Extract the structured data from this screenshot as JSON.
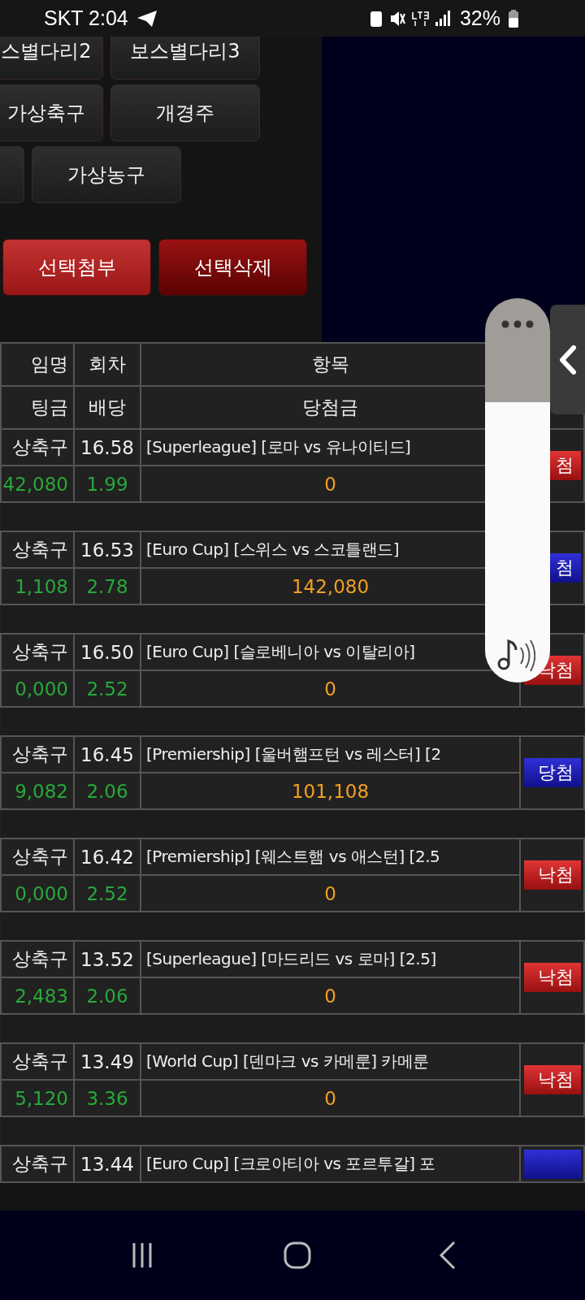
{
  "status_bar": {
    "carrier_time": "SKT 2:04",
    "battery": "32%"
  },
  "menu_rows": [
    {
      "buttons": [
        {
          "label": "스별다리2"
        },
        {
          "label": "보스별다리3"
        }
      ]
    },
    {
      "buttons": [
        {
          "label": "가상축구"
        },
        {
          "label": "개경주"
        }
      ]
    },
    {
      "buttons": [
        {
          "kind": "blank"
        },
        {
          "label": "가상농구"
        }
      ]
    }
  ],
  "actions": [
    {
      "label": "선택첨부",
      "kind": "attach"
    },
    {
      "label": "선택삭제",
      "kind": "delete"
    }
  ],
  "table": {
    "header": [
      [
        "임명",
        "회차",
        "항목"
      ],
      [
        "팅금",
        "배당",
        "당첨금"
      ]
    ],
    "bets": [
      {
        "game": "상축구",
        "round": "16.58",
        "item": "[Superleague] [로마 vs 유나이티드]",
        "stake": "42,080",
        "odds": "1.99",
        "payout": "0",
        "result": {
          "kind": "lose",
          "label": "첨"
        }
      },
      {
        "game": "상축구",
        "round": "16.53",
        "item": "[Euro Cup] [스위스 vs 스코틀랜드]",
        "stake": "1,108",
        "odds": "2.78",
        "payout": "142,080",
        "result": {
          "kind": "win",
          "label": "첨"
        }
      },
      {
        "game": "상축구",
        "round": "16.50",
        "item": "[Euro Cup] [슬로베니아 vs 이탈리아]",
        "stake": "0,000",
        "odds": "2.52",
        "payout": "0",
        "result": {
          "kind": "lose",
          "label": "낙첨"
        }
      },
      {
        "game": "상축구",
        "round": "16.45",
        "item": "[Premiership] [울버햄프턴 vs 레스터] [2",
        "stake": "9,082",
        "odds": "2.06",
        "payout": "101,108",
        "result": {
          "kind": "win",
          "label": "당첨"
        }
      },
      {
        "game": "상축구",
        "round": "16.42",
        "item": "[Premiership] [웨스트햄 vs 애스턴] [2.5",
        "stake": "0,000",
        "odds": "2.52",
        "payout": "0",
        "result": {
          "kind": "lose",
          "label": "낙첨"
        }
      },
      {
        "game": "상축구",
        "round": "13.52",
        "item": "[Superleague] [마드리드 vs 로마] [2.5]",
        "stake": "2,483",
        "odds": "2.06",
        "payout": "0",
        "result": {
          "kind": "lose",
          "label": "낙첨"
        }
      },
      {
        "game": "상축구",
        "round": "13.49",
        "item": "[World Cup] [덴마크 vs 카메룬] 카메룬",
        "stake": "5,120",
        "odds": "3.36",
        "payout": "0",
        "result": {
          "kind": "lose",
          "label": "낙첨"
        }
      },
      {
        "game": "상축구",
        "round": "13.44",
        "item": "[Euro Cup] [크로아티아 vs 포르투갈] 포",
        "result": {
          "kind": "win"
        }
      }
    ]
  },
  "volume": {
    "level": 0.73
  }
}
